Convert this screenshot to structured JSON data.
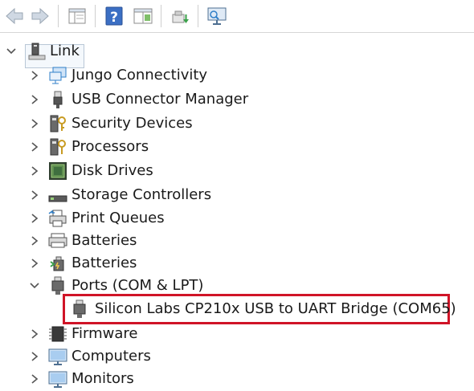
{
  "toolbar": {
    "buttons": [
      {
        "name": "back-button",
        "icon": "arrow-left-icon"
      },
      {
        "name": "forward-button",
        "icon": "arrow-right-icon"
      },
      {
        "name": "show-hide-tree-button",
        "icon": "console-tree-icon"
      },
      {
        "name": "help-button",
        "icon": "help-icon",
        "glyph": "?"
      },
      {
        "name": "properties-button",
        "icon": "properties-icon"
      },
      {
        "name": "update-driver-button",
        "icon": "update-driver-icon"
      },
      {
        "name": "scan-hardware-button",
        "icon": "scan-monitor-icon"
      }
    ]
  },
  "tree": {
    "root": {
      "label": "Link",
      "expanded": true,
      "icon": "computer-icon"
    },
    "items": [
      {
        "label": "Jungo Connectivity",
        "icon": "network-icon",
        "expanded": false
      },
      {
        "label": "USB Connector Manager",
        "icon": "usb-plug-icon",
        "expanded": false
      },
      {
        "label": "Security Devices",
        "icon": "security-device-icon",
        "expanded": false
      },
      {
        "label": "Processors",
        "icon": "processor-icon",
        "expanded": false
      },
      {
        "label": "Disk Drives",
        "icon": "disk-drive-icon",
        "expanded": false
      },
      {
        "label": "Storage Controllers",
        "icon": "storage-controller-icon",
        "expanded": false
      },
      {
        "label": "Print Queues",
        "icon": "printer-icon",
        "expanded": false
      },
      {
        "label": "Batteries",
        "icon": "battery-icon",
        "expanded": false
      },
      {
        "label": "Batteries",
        "icon": "battery-plug-icon",
        "expanded": false
      },
      {
        "label": "Ports (COM & LPT)",
        "icon": "port-icon",
        "expanded": true,
        "children": [
          {
            "label": "Silicon Labs CP210x USB to UART Bridge (COM65)",
            "icon": "port-icon",
            "selected": true
          }
        ]
      },
      {
        "label": "Firmware",
        "icon": "firmware-icon",
        "expanded": false
      },
      {
        "label": "Computers",
        "icon": "monitor-icon",
        "expanded": false
      },
      {
        "label": "Monitors",
        "icon": "monitor-icon",
        "expanded": false
      }
    ]
  },
  "colors": {
    "highlight_border": "#d01427",
    "chevron": "#555555",
    "icon_blue": "#2f7fc8",
    "icon_gray": "#7a7a7a"
  }
}
